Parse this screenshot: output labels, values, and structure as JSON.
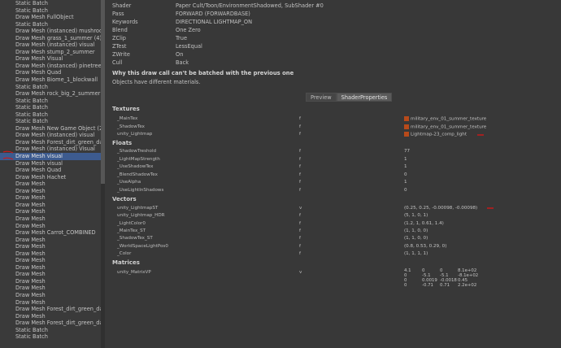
{
  "left_list": [
    "Static Batch",
    "Static Batch",
    "Draw Mesh FullObject",
    "Static Batch",
    "Draw Mesh (instanced) mushroom_",
    "Draw Mesh grass_1_summer (4)",
    "Draw Mesh (instanced) visual",
    "Draw Mesh stump_2_summer",
    "Draw Mesh Visual",
    "Draw Mesh (instanced) pinetree_1_",
    "Draw Mesh Quad",
    "Draw Mesh Biome_1_blockwall",
    "Static Batch",
    "Draw Mesh rock_big_2_summer (6",
    "Static Batch",
    "Static Batch",
    "Static Batch",
    "Static Batch",
    "Draw Mesh New Game Object (2)",
    "Draw Mesh (instanced) visual",
    "Draw Mesh Forest_dirt_green_dark",
    "Draw Mesh (instanced) Visual",
    "Draw Mesh visual",
    "Draw Mesh visual",
    "Draw Mesh Quad",
    "Draw Mesh Hachet",
    "Draw Mesh",
    "Draw Mesh",
    "Draw Mesh",
    "Draw Mesh",
    "Draw Mesh",
    "Draw Mesh",
    "Draw Mesh",
    "Draw Mesh Carrot_COMBINED",
    "Draw Mesh",
    "Draw Mesh",
    "Draw Mesh",
    "Draw Mesh",
    "Draw Mesh",
    "Draw Mesh",
    "Draw Mesh",
    "Draw Mesh",
    "Draw Mesh",
    "Draw Mesh",
    "Draw Mesh Forest_dirt_green_dark",
    "Draw Mesh",
    "Draw Mesh Forest_dirt_green_dark",
    "Static Batch",
    "Static Batch"
  ],
  "selected_index": 22,
  "details": [
    {
      "label": "Shader",
      "value": "Paper Cult/Toon/EnvironmentShadowed, SubShader #0"
    },
    {
      "label": "Pass",
      "value": "FORWARD (FORWARDBASE)"
    },
    {
      "label": "Keywords",
      "value": "DIRECTIONAL LIGHTMAP_ON"
    },
    {
      "label": "Blend",
      "value": "One Zero"
    },
    {
      "label": "ZClip",
      "value": "True"
    },
    {
      "label": "ZTest",
      "value": "LessEqual"
    },
    {
      "label": "ZWrite",
      "value": "On"
    },
    {
      "label": "Cull",
      "value": "Back"
    }
  ],
  "why_title": "Why this draw call can't be batched with the previous one",
  "why_reason": "Objects have different materials.",
  "tabs": [
    {
      "label": "Preview",
      "active": false
    },
    {
      "label": "ShaderProperties",
      "active": true
    }
  ],
  "sections": {
    "textures": {
      "title": "Textures",
      "rows": [
        {
          "name": "_MainTex",
          "type": "f",
          "value": "military_env_01_summer_texture",
          "icon": "texture-icon"
        },
        {
          "name": "_ShadowTex",
          "type": "f",
          "value": "military_env_01_summer_texture",
          "icon": "texture-icon"
        },
        {
          "name": "unity_Lightmap",
          "type": "f",
          "value": "Lightmap-23_comp_light",
          "icon": "texture-icon"
        }
      ]
    },
    "floats": {
      "title": "Floats",
      "rows": [
        {
          "name": "_ShadowTreshold",
          "type": "f",
          "value": "77"
        },
        {
          "name": "_LightMapStrength",
          "type": "f",
          "value": "1"
        },
        {
          "name": "_UseShadowTex",
          "type": "f",
          "value": "1"
        },
        {
          "name": "_BlendShadowTex",
          "type": "f",
          "value": "0"
        },
        {
          "name": "_UseAlpha",
          "type": "f",
          "value": "1"
        },
        {
          "name": "_UseLightInShadows",
          "type": "f",
          "value": "0"
        }
      ]
    },
    "vectors": {
      "title": "Vectors",
      "rows": [
        {
          "name": "unity_LightmapST",
          "type": "v",
          "value": "(0.25, 0.25, -0.00098, -0.00098)"
        },
        {
          "name": "unity_Lightmap_HDR",
          "type": "f",
          "value": "(5, 1, 0, 1)"
        },
        {
          "name": "_LightColor0",
          "type": "f",
          "value": "(1.2, 1, 0.61, 1.4)"
        },
        {
          "name": "_MainTex_ST",
          "type": "f",
          "value": "(1, 1, 0, 0)"
        },
        {
          "name": "_ShadowTex_ST",
          "type": "f",
          "value": "(1, 1, 0, 0)"
        },
        {
          "name": "_WorldSpaceLightPos0",
          "type": "f",
          "value": "(0.8, 0.53, 0.29, 0)"
        },
        {
          "name": "_Color",
          "type": "f",
          "value": "(1, 1, 1, 1)"
        }
      ]
    },
    "matrices": {
      "title": "Matrices",
      "rows": [
        {
          "name": "unity_MatrixVP",
          "type": "v",
          "matrix": [
            [
              "4.1",
              "0",
              "0",
              "8.1e+02"
            ],
            [
              "0",
              "-5.1",
              "-5.1",
              "-8.1e+02"
            ],
            [
              "0",
              "0.0019",
              "-0.0018",
              "0.45"
            ],
            [
              "0",
              "-0.71",
              "0.71",
              "2.2e+02"
            ]
          ]
        }
      ]
    }
  },
  "colors": {
    "selection": "#3d5b8f",
    "annotation": "#d01818",
    "texture_icon": "#b84a1a"
  }
}
